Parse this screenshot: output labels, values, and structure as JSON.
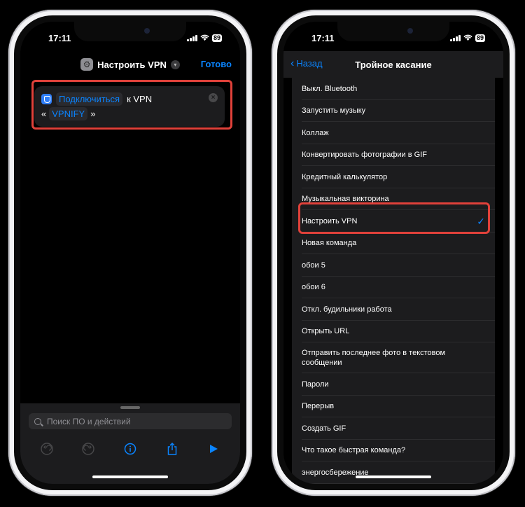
{
  "left_phone": {
    "status": {
      "time": "17:11",
      "battery": "89"
    },
    "header": {
      "title": "Настроить VPN",
      "done_label": "Готово"
    },
    "action": {
      "verb": "Подключиться",
      "connector": "к VPN",
      "quote_open": "«",
      "vpn_name": "VPNIFY",
      "quote_close": "»"
    },
    "search": {
      "placeholder": "Поиск ПО и действий"
    },
    "toolbar": [
      "undo-icon",
      "redo-icon",
      "info-icon",
      "share-icon",
      "play-icon"
    ]
  },
  "right_phone": {
    "status": {
      "time": "17:11",
      "battery": "89"
    },
    "header": {
      "back_label": "Назад",
      "title": "Тройное касание"
    },
    "items": [
      "Выкл. Bluetooth",
      "Запустить музыку",
      "Коллаж",
      "Конвертировать фотографии в GIF",
      "Кредитный калькулятор",
      "Музыкальная викторина",
      "Настроить VPN",
      "Новая команда",
      "обои 5",
      "обои 6",
      "Откл. будильники работа",
      "Открыть URL",
      "Отправить последнее фото в текстовом сообщении",
      "Пароли",
      "Перерыв",
      "Создать GIF",
      "Что такое быстрая команда?",
      "энергосбережение"
    ],
    "selected_index": 6
  },
  "colors": {
    "accent": "#0a84ff",
    "highlight": "#e0413a"
  }
}
